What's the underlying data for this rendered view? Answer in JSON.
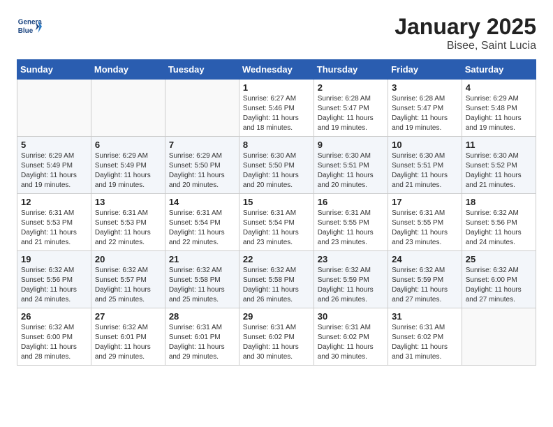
{
  "logo": {
    "line1": "General",
    "line2": "Blue"
  },
  "title": "January 2025",
  "subtitle": "Bisee, Saint Lucia",
  "days_of_week": [
    "Sunday",
    "Monday",
    "Tuesday",
    "Wednesday",
    "Thursday",
    "Friday",
    "Saturday"
  ],
  "weeks": [
    [
      {
        "day": "",
        "info": ""
      },
      {
        "day": "",
        "info": ""
      },
      {
        "day": "",
        "info": ""
      },
      {
        "day": "1",
        "info": "Sunrise: 6:27 AM\nSunset: 5:46 PM\nDaylight: 11 hours\nand 18 minutes."
      },
      {
        "day": "2",
        "info": "Sunrise: 6:28 AM\nSunset: 5:47 PM\nDaylight: 11 hours\nand 19 minutes."
      },
      {
        "day": "3",
        "info": "Sunrise: 6:28 AM\nSunset: 5:47 PM\nDaylight: 11 hours\nand 19 minutes."
      },
      {
        "day": "4",
        "info": "Sunrise: 6:29 AM\nSunset: 5:48 PM\nDaylight: 11 hours\nand 19 minutes."
      }
    ],
    [
      {
        "day": "5",
        "info": "Sunrise: 6:29 AM\nSunset: 5:49 PM\nDaylight: 11 hours\nand 19 minutes."
      },
      {
        "day": "6",
        "info": "Sunrise: 6:29 AM\nSunset: 5:49 PM\nDaylight: 11 hours\nand 19 minutes."
      },
      {
        "day": "7",
        "info": "Sunrise: 6:29 AM\nSunset: 5:50 PM\nDaylight: 11 hours\nand 20 minutes."
      },
      {
        "day": "8",
        "info": "Sunrise: 6:30 AM\nSunset: 5:50 PM\nDaylight: 11 hours\nand 20 minutes."
      },
      {
        "day": "9",
        "info": "Sunrise: 6:30 AM\nSunset: 5:51 PM\nDaylight: 11 hours\nand 20 minutes."
      },
      {
        "day": "10",
        "info": "Sunrise: 6:30 AM\nSunset: 5:51 PM\nDaylight: 11 hours\nand 21 minutes."
      },
      {
        "day": "11",
        "info": "Sunrise: 6:30 AM\nSunset: 5:52 PM\nDaylight: 11 hours\nand 21 minutes."
      }
    ],
    [
      {
        "day": "12",
        "info": "Sunrise: 6:31 AM\nSunset: 5:53 PM\nDaylight: 11 hours\nand 21 minutes."
      },
      {
        "day": "13",
        "info": "Sunrise: 6:31 AM\nSunset: 5:53 PM\nDaylight: 11 hours\nand 22 minutes."
      },
      {
        "day": "14",
        "info": "Sunrise: 6:31 AM\nSunset: 5:54 PM\nDaylight: 11 hours\nand 22 minutes."
      },
      {
        "day": "15",
        "info": "Sunrise: 6:31 AM\nSunset: 5:54 PM\nDaylight: 11 hours\nand 23 minutes."
      },
      {
        "day": "16",
        "info": "Sunrise: 6:31 AM\nSunset: 5:55 PM\nDaylight: 11 hours\nand 23 minutes."
      },
      {
        "day": "17",
        "info": "Sunrise: 6:31 AM\nSunset: 5:55 PM\nDaylight: 11 hours\nand 23 minutes."
      },
      {
        "day": "18",
        "info": "Sunrise: 6:32 AM\nSunset: 5:56 PM\nDaylight: 11 hours\nand 24 minutes."
      }
    ],
    [
      {
        "day": "19",
        "info": "Sunrise: 6:32 AM\nSunset: 5:56 PM\nDaylight: 11 hours\nand 24 minutes."
      },
      {
        "day": "20",
        "info": "Sunrise: 6:32 AM\nSunset: 5:57 PM\nDaylight: 11 hours\nand 25 minutes."
      },
      {
        "day": "21",
        "info": "Sunrise: 6:32 AM\nSunset: 5:58 PM\nDaylight: 11 hours\nand 25 minutes."
      },
      {
        "day": "22",
        "info": "Sunrise: 6:32 AM\nSunset: 5:58 PM\nDaylight: 11 hours\nand 26 minutes."
      },
      {
        "day": "23",
        "info": "Sunrise: 6:32 AM\nSunset: 5:59 PM\nDaylight: 11 hours\nand 26 minutes."
      },
      {
        "day": "24",
        "info": "Sunrise: 6:32 AM\nSunset: 5:59 PM\nDaylight: 11 hours\nand 27 minutes."
      },
      {
        "day": "25",
        "info": "Sunrise: 6:32 AM\nSunset: 6:00 PM\nDaylight: 11 hours\nand 27 minutes."
      }
    ],
    [
      {
        "day": "26",
        "info": "Sunrise: 6:32 AM\nSunset: 6:00 PM\nDaylight: 11 hours\nand 28 minutes."
      },
      {
        "day": "27",
        "info": "Sunrise: 6:32 AM\nSunset: 6:01 PM\nDaylight: 11 hours\nand 29 minutes."
      },
      {
        "day": "28",
        "info": "Sunrise: 6:31 AM\nSunset: 6:01 PM\nDaylight: 11 hours\nand 29 minutes."
      },
      {
        "day": "29",
        "info": "Sunrise: 6:31 AM\nSunset: 6:02 PM\nDaylight: 11 hours\nand 30 minutes."
      },
      {
        "day": "30",
        "info": "Sunrise: 6:31 AM\nSunset: 6:02 PM\nDaylight: 11 hours\nand 30 minutes."
      },
      {
        "day": "31",
        "info": "Sunrise: 6:31 AM\nSunset: 6:02 PM\nDaylight: 11 hours\nand 31 minutes."
      },
      {
        "day": "",
        "info": ""
      }
    ]
  ]
}
